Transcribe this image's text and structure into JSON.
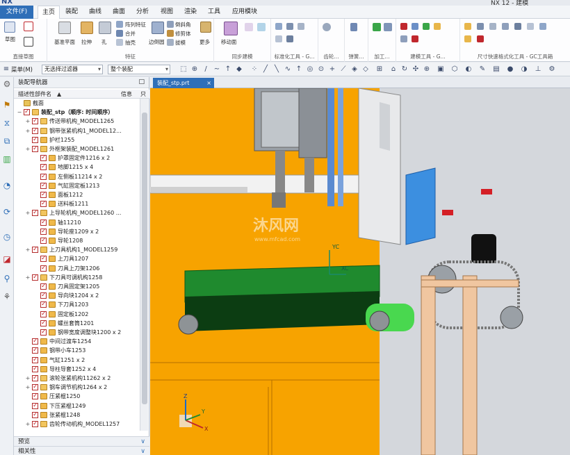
{
  "titlebar": {
    "logo": "NX",
    "app_title": "NX 12 - 建模"
  },
  "ribbon_tabs": {
    "file": "文件(F)",
    "tabs": [
      "主页",
      "装配",
      "曲线",
      "曲面",
      "分析",
      "视图",
      "渲染",
      "工具",
      "应用模块"
    ],
    "active": "主页"
  },
  "ribbon": {
    "sketch": "草图",
    "direct_sketch_group": "直接草图",
    "datum_plane": "基准平面",
    "extrude": "拉伸",
    "hole": "孔",
    "array_feature": "阵列特征",
    "unite": "合并",
    "shell": "抽壳",
    "feature_group": "特征",
    "edge_blend": "边倒圆",
    "chamfer": "倒斜角",
    "trim_body": "修剪体",
    "draft": "拔模",
    "more": "更多",
    "move_face": "移动面",
    "sync_group": "同步建模",
    "std_group": "标准化工具 - G...",
    "gear_group": "齿轮...",
    "spring_group": "弹簧...",
    "machining_group": "加工...",
    "build_group": "建模工具 - G...",
    "dim_group": "尺寸快速格式化工具 - GC工具箱"
  },
  "selection_bar": {
    "menu": "菜单(M)",
    "filter": "无选择过滤器",
    "scope": "整个装配"
  },
  "navigator": {
    "title": "装配导航器",
    "col_name": "描述性部件名",
    "col_info": "信息",
    "col_read": "只",
    "rows": [
      {
        "label": "截面",
        "level": 0,
        "kind": "folder"
      },
      {
        "label": "装配_stp（顺序: 时间顺序）",
        "level": 0,
        "kind": "root"
      },
      {
        "label": "传送带机构_MODEL1265",
        "level": 1,
        "kind": "asm"
      },
      {
        "label": "钢带张紧机构1_MODEL12...",
        "level": 1,
        "kind": "asm"
      },
      {
        "label": "护栏1255",
        "level": 1,
        "kind": "part"
      },
      {
        "label": "外框架装配_MODEL1261",
        "level": 1,
        "kind": "asm"
      },
      {
        "label": "护罩固定件1216 x 2",
        "level": 2,
        "kind": "part"
      },
      {
        "label": "地脚1215 x 4",
        "level": 2,
        "kind": "part"
      },
      {
        "label": "左侧板11214 x 2",
        "level": 2,
        "kind": "part"
      },
      {
        "label": "气缸固定板1213",
        "level": 2,
        "kind": "part"
      },
      {
        "label": "面板1212",
        "level": 2,
        "kind": "part"
      },
      {
        "label": "送料板1211",
        "level": 2,
        "kind": "part"
      },
      {
        "label": "上导轮机构_MODEL1260 ...",
        "level": 1,
        "kind": "asm"
      },
      {
        "label": "轴11210",
        "level": 2,
        "kind": "part"
      },
      {
        "label": "导轮座1209 x 2",
        "level": 2,
        "kind": "part"
      },
      {
        "label": "导轮1208",
        "level": 2,
        "kind": "part"
      },
      {
        "label": "上刀具机构1_MODEL1259",
        "level": 1,
        "kind": "asm"
      },
      {
        "label": "上刀具1207",
        "level": 2,
        "kind": "part"
      },
      {
        "label": "刀具上刀架1206",
        "level": 2,
        "kind": "part"
      },
      {
        "label": "下刀具可调机构1258",
        "level": 1,
        "kind": "asm"
      },
      {
        "label": "刀具固定架1205",
        "level": 2,
        "kind": "part"
      },
      {
        "label": "导向块1204 x 2",
        "level": 2,
        "kind": "part"
      },
      {
        "label": "下刀具1203",
        "level": 2,
        "kind": "part"
      },
      {
        "label": "固定板1202",
        "level": 2,
        "kind": "part"
      },
      {
        "label": "螺丝套筒1201",
        "level": 2,
        "kind": "part"
      },
      {
        "label": "钢带宽度调整块1200 x 2",
        "level": 2,
        "kind": "part"
      },
      {
        "label": "中间过渡车1254",
        "level": 1,
        "kind": "part"
      },
      {
        "label": "钢带小车1253",
        "level": 1,
        "kind": "part"
      },
      {
        "label": "气缸1251 x 2",
        "level": 1,
        "kind": "part"
      },
      {
        "label": "导柱导套1252 x 4",
        "level": 1,
        "kind": "part"
      },
      {
        "label": "滚轮张紧机构11262 x 2",
        "level": 1,
        "kind": "asm"
      },
      {
        "label": "钢车调节机构1264 x 2",
        "level": 1,
        "kind": "asm"
      },
      {
        "label": "压紧棍1250",
        "level": 1,
        "kind": "part"
      },
      {
        "label": "下压紧棍1249",
        "level": 1,
        "kind": "part"
      },
      {
        "label": "张紧棍1248",
        "level": 1,
        "kind": "part"
      },
      {
        "label": "齿轮传动机构_MODEL1257",
        "level": 1,
        "kind": "asm"
      }
    ],
    "preview": "预览",
    "dependencies": "相关性"
  },
  "graphics": {
    "tab_label": "装配_stp.prt",
    "axis_yc": "YC",
    "axis_xc": "XC",
    "triad_z": "Z",
    "triad_x": "X",
    "triad_y": "Y",
    "watermark": "沐风网",
    "watermark_url": "www.mfcad.com"
  },
  "colors": {
    "accent": "#2f6fb8",
    "frame_orange": "#f7a300",
    "belt_green": "#1f8a2e",
    "guard_blue": "#3c8fe0"
  }
}
